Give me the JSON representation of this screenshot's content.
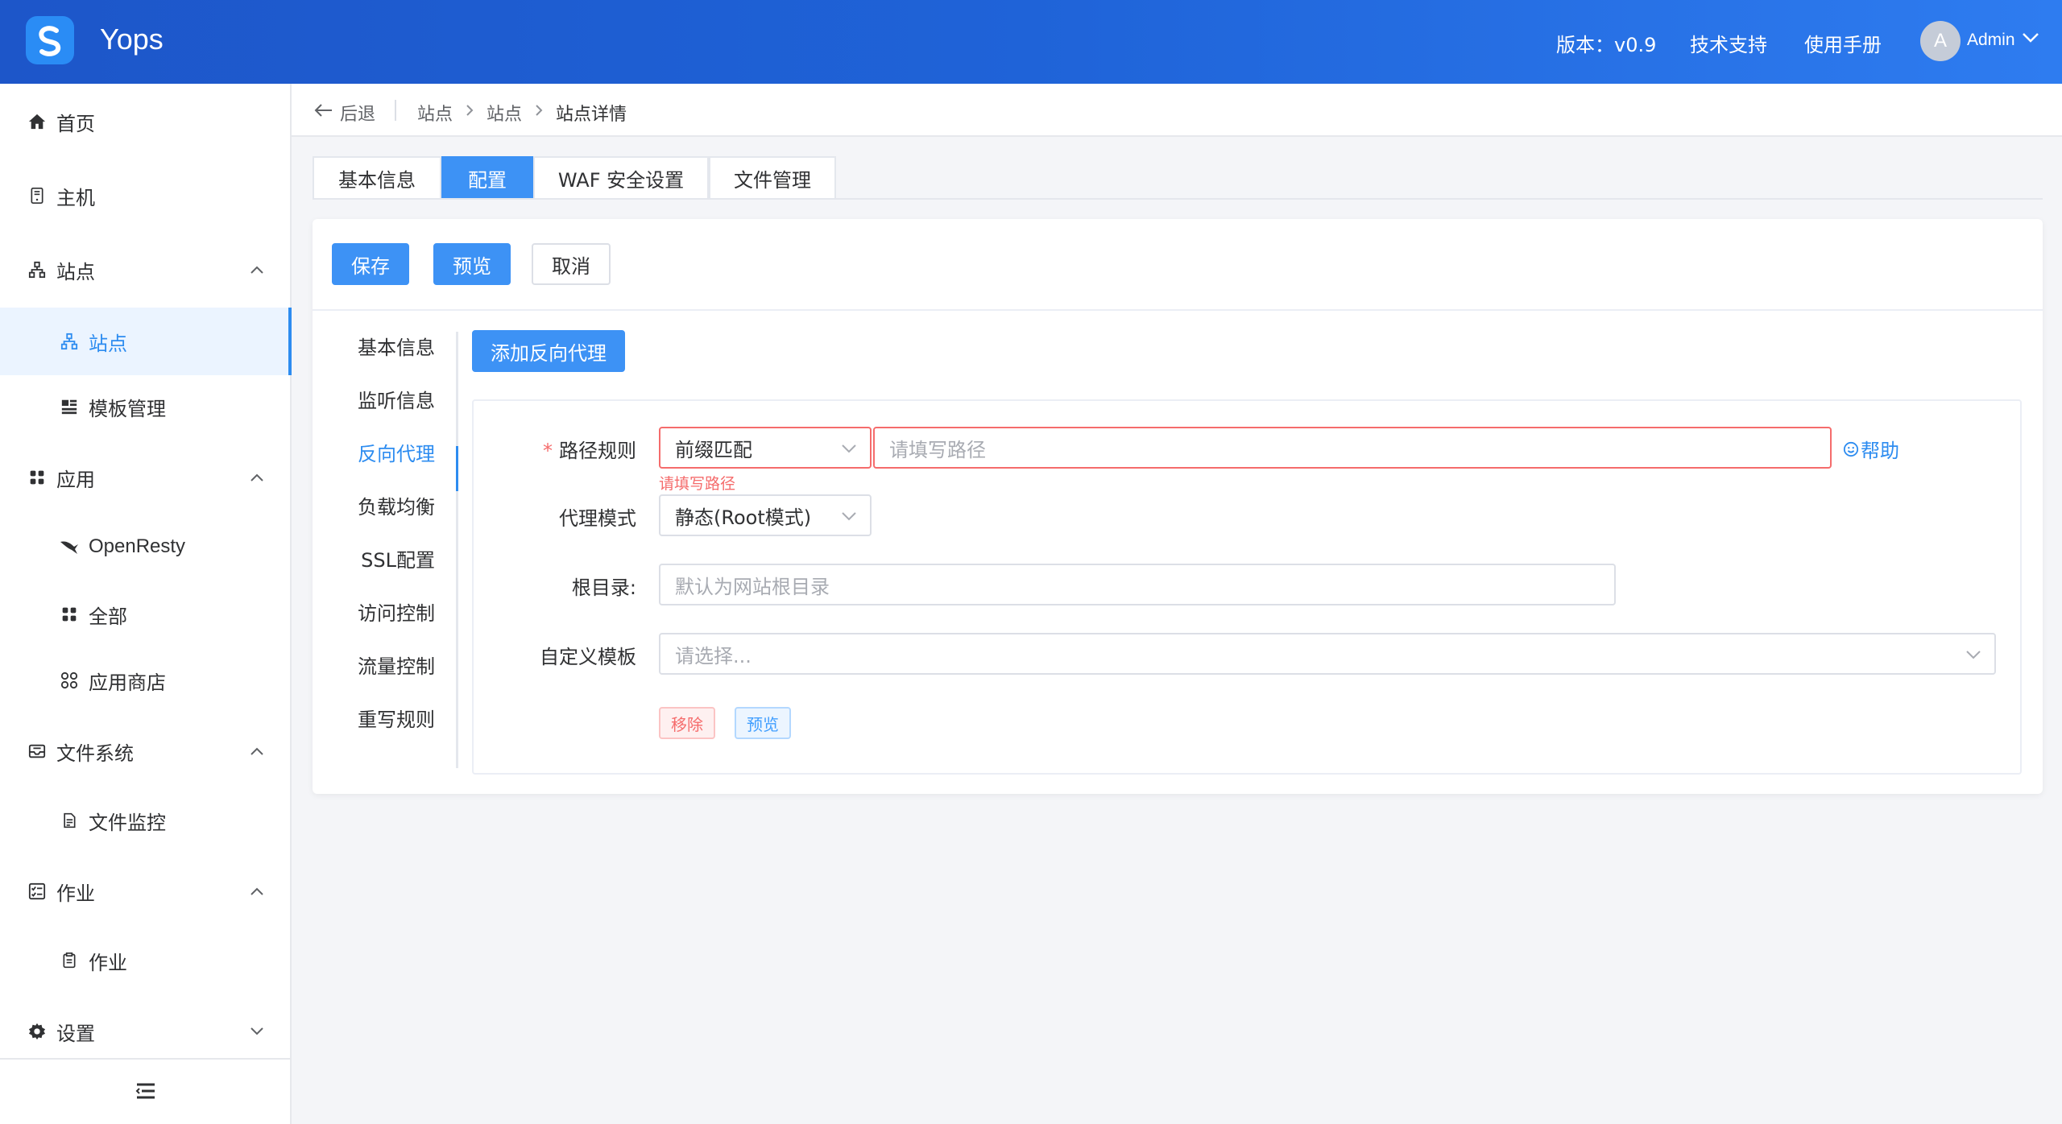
{
  "header": {
    "app_name": "Yops",
    "version": "版本：v0.9",
    "support": "技术支持",
    "manual": "使用手册",
    "avatar_letter": "A",
    "user_name": "Admin"
  },
  "sidebar": {
    "items": [
      {
        "label": "首页",
        "icon": "home-icon"
      },
      {
        "label": "主机",
        "icon": "server-icon"
      },
      {
        "label": "站点",
        "icon": "sitemap-icon",
        "expanded": true
      },
      {
        "label": "站点",
        "icon": "sitemap-icon",
        "active": true
      },
      {
        "label": "模板管理",
        "icon": "template-icon"
      },
      {
        "label": "应用",
        "icon": "apps-icon",
        "expanded": true
      },
      {
        "label": "OpenResty",
        "icon": "openresty-icon"
      },
      {
        "label": "全部",
        "icon": "apps-icon"
      },
      {
        "label": "应用商店",
        "icon": "store-icon"
      },
      {
        "label": "文件系统",
        "icon": "inbox-icon",
        "expanded": true
      },
      {
        "label": "文件监控",
        "icon": "file-monitor-icon"
      },
      {
        "label": "作业",
        "icon": "task-list-icon",
        "expanded": true
      },
      {
        "label": "作业",
        "icon": "clipboard-icon"
      },
      {
        "label": "设置",
        "icon": "gear-icon",
        "expanded": false
      }
    ]
  },
  "breadcrumb": {
    "back": "后退",
    "items": [
      "站点",
      "站点",
      "站点详情"
    ]
  },
  "tabs": [
    "基本信息",
    "配置",
    "WAF 安全设置",
    "文件管理"
  ],
  "actions": {
    "save": "保存",
    "preview": "预览",
    "cancel": "取消"
  },
  "anchors": [
    "基本信息",
    "监听信息",
    "反向代理",
    "负载均衡",
    "SSL配置",
    "访问控制",
    "流量控制",
    "重写规则"
  ],
  "proxy": {
    "add_button": "添加反向代理",
    "path_rule_label": "路径规则",
    "match_type": "前缀匹配",
    "path_placeholder": "请填写路径",
    "path_error": "请填写路径",
    "help": "帮助",
    "mode_label": "代理模式",
    "mode_value": "静态(Root模式)",
    "root_label": "根目录:",
    "root_placeholder": "默认为网站根目录",
    "template_label": "自定义模板",
    "template_placeholder": "请选择...",
    "remove_tag": "移除",
    "preview_tag": "预览"
  },
  "colors": {
    "primary": "#3d92f5",
    "error": "#f56c6c",
    "header_gradient_start": "#1d56c9",
    "header_gradient_end": "#2e7cf0"
  }
}
